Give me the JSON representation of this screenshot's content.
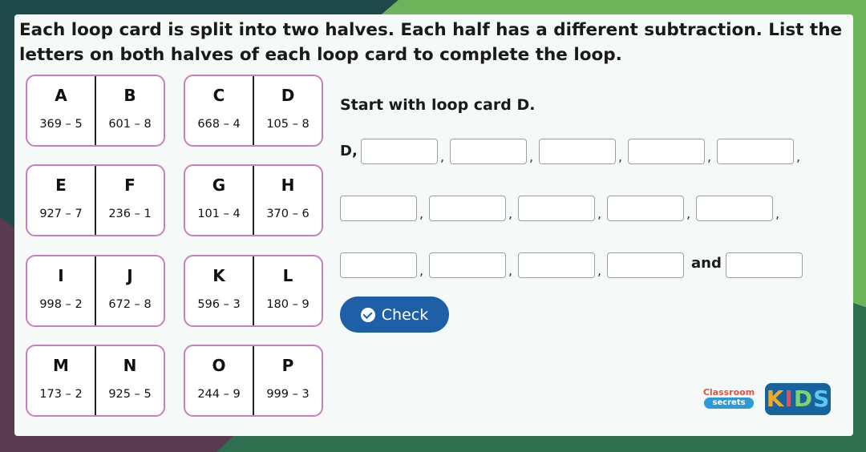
{
  "instruction": "Each loop card is split into two halves. Each half has a different subtraction. List the letters on both halves of each loop card to complete the loop.",
  "cards": [
    {
      "left": {
        "letter": "A",
        "calc": "369 – 5"
      },
      "right": {
        "letter": "B",
        "calc": "601 – 8"
      }
    },
    {
      "left": {
        "letter": "C",
        "calc": "668 – 4"
      },
      "right": {
        "letter": "D",
        "calc": "105 – 8"
      }
    },
    {
      "left": {
        "letter": "E",
        "calc": "927 – 7"
      },
      "right": {
        "letter": "F",
        "calc": "236 – 1"
      }
    },
    {
      "left": {
        "letter": "G",
        "calc": "101 – 4"
      },
      "right": {
        "letter": "H",
        "calc": "370 – 6"
      }
    },
    {
      "left": {
        "letter": "I",
        "calc": "998 – 2"
      },
      "right": {
        "letter": "J",
        "calc": "672 – 8"
      }
    },
    {
      "left": {
        "letter": "K",
        "calc": "596 – 3"
      },
      "right": {
        "letter": "L",
        "calc": "180 – 9"
      }
    },
    {
      "left": {
        "letter": "M",
        "calc": "173 – 2"
      },
      "right": {
        "letter": "N",
        "calc": "925 – 5"
      }
    },
    {
      "left": {
        "letter": "O",
        "calc": "244 – 9"
      },
      "right": {
        "letter": "P",
        "calc": "999 – 3"
      }
    }
  ],
  "prompt": "Start with loop card D.",
  "start_label": "D,",
  "comma": ",",
  "and_label": "and",
  "answers": [
    "",
    "",
    "",
    "",
    "",
    "",
    "",
    "",
    "",
    "",
    "",
    "",
    "",
    "",
    ""
  ],
  "check_label": "Check",
  "logo": {
    "line1": "Classroom",
    "line2": "secrets",
    "kids": [
      "K",
      "I",
      "D",
      "S"
    ]
  },
  "colors": {
    "card_border": "#c87fc0",
    "button": "#1e5fa8",
    "kids_bg": "#16639e"
  }
}
